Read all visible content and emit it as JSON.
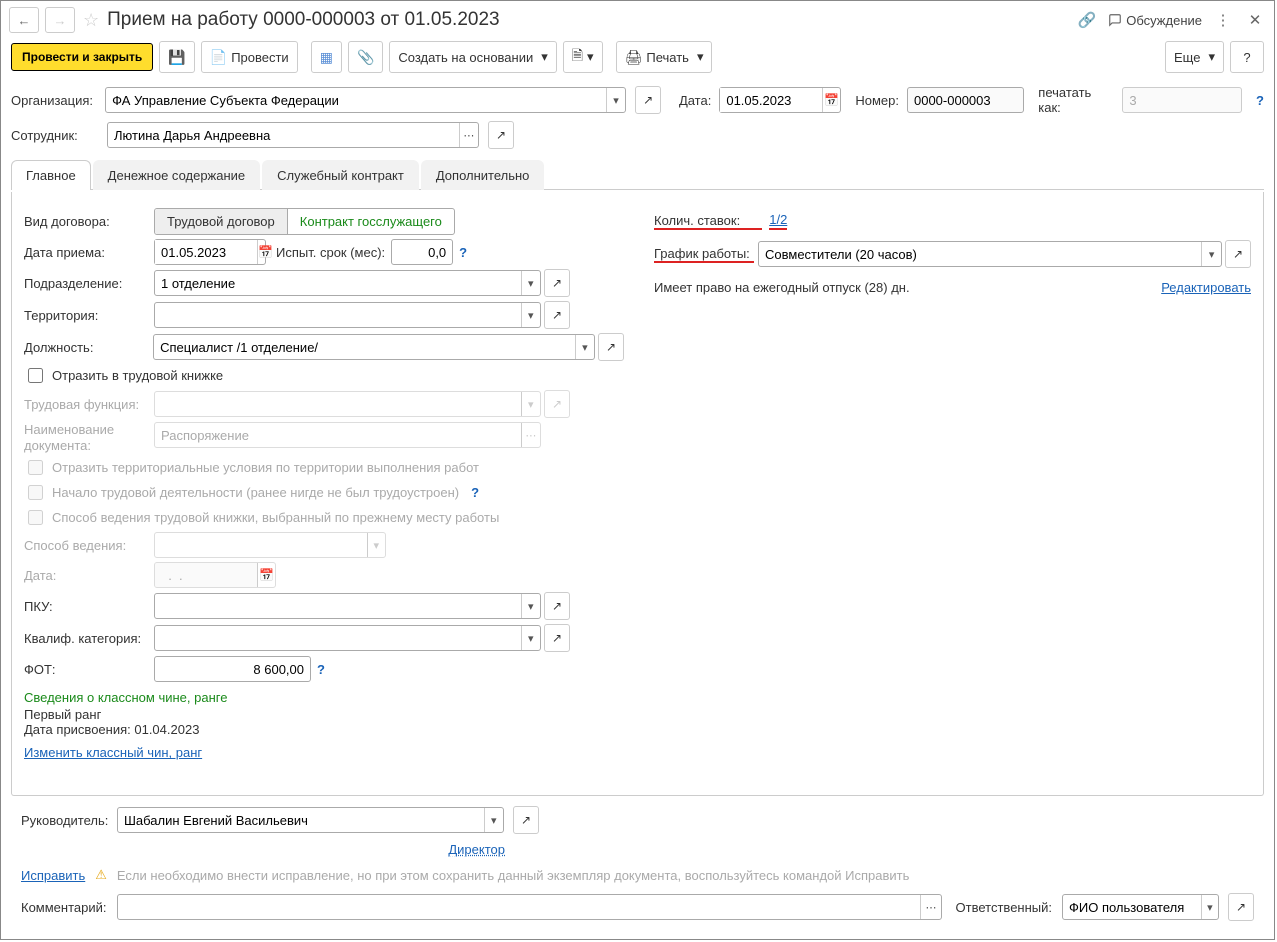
{
  "header": {
    "title": "Прием на работу 0000-000003 от 01.05.2023",
    "discussion": "Обсуждение",
    "more_btn": "Еще"
  },
  "toolbar": {
    "post_close": "Провести и закрыть",
    "post": "Провести",
    "create_based": "Создать на основании",
    "print": "Печать"
  },
  "fields": {
    "organization_label": "Организация:",
    "organization_value": "ФА Управление Субъекта Федерации",
    "date_label": "Дата:",
    "date_value": "01.05.2023",
    "number_label": "Номер:",
    "number_value": "0000-000003",
    "print_as_label": "печатать как:",
    "print_as_value": "3",
    "employee_label": "Сотрудник:",
    "employee_value": "Лютина Дарья Андреевна"
  },
  "tabs": {
    "main": "Главное",
    "salary": "Денежное содержание",
    "contract": "Служебный контракт",
    "addl": "Дополнительно"
  },
  "main": {
    "contract_type_label": "Вид договора:",
    "labor_contract": "Трудовой договор",
    "service_contract": "Контракт госслужащего",
    "hire_date_label": "Дата приема:",
    "hire_date_value": "01.05.2023",
    "probation_label": "Испыт. срок (мес):",
    "probation_value": "0,0",
    "department_label": "Подразделение:",
    "department_value": "1 отделение",
    "territory_label": "Территория:",
    "territory_value": "",
    "position_label": "Должность:",
    "position_value": "Специалист /1 отделение/",
    "reflect_workbook": "Отразить в трудовой книжке",
    "labor_function_label": "Трудовая функция:",
    "doc_name_label": "Наименование документа:",
    "doc_name_value": "Распоряжение",
    "reflect_terr": "Отразить территориальные условия по территории выполнения работ",
    "labor_start": "Начало трудовой деятельности (ранее нигде не был трудоустроен)",
    "workbook_method": "Способ ведения трудовой книжки, выбранный по прежнему месту работы",
    "method_label": "Способ ведения:",
    "date2_label": "Дата:",
    "date2_value": "  .  .    ",
    "pku_label": "ПКУ:",
    "qual_label": "Квалиф. категория:",
    "fot_label": "ФОТ:",
    "fot_value": "8 600,00",
    "rank_info": "Сведения о классном чине, ранге",
    "first_rank": "Первый ранг",
    "rank_date": "Дата присвоения: 01.04.2023",
    "change_rank": "Изменить классный чин, ранг",
    "rates_label": "Колич. ставок:",
    "rates_value": "1/2",
    "schedule_label": "График работы:",
    "schedule_value": "Совместители (20 часов)",
    "vacation_text": "Имеет право на ежегодный отпуск (28) дн.",
    "edit_link": "Редактировать"
  },
  "footer": {
    "manager_label": "Руководитель:",
    "manager_value": "Шабалин Евгений Васильевич",
    "manager_role": "Директор",
    "fix": "Исправить",
    "fix_note": "Если необходимо внести исправление, но при этом сохранить данный экземпляр документа, воспользуйтесь командой Исправить",
    "comment_label": "Комментарий:",
    "responsible_label": "Ответственный:",
    "responsible_value": "ФИО пользователя"
  }
}
